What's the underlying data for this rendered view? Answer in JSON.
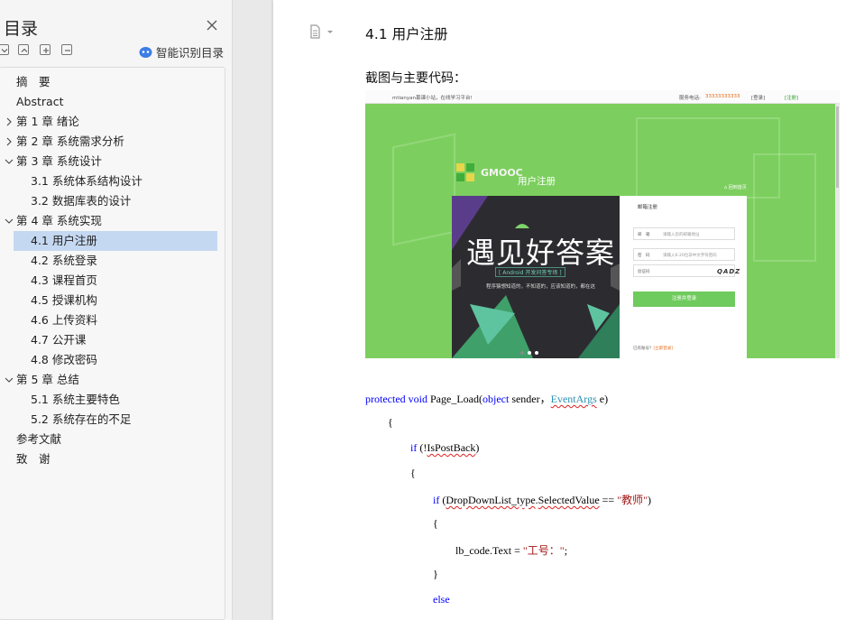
{
  "sidebar": {
    "title": "目录",
    "smart_toc_label": "智能识别目录",
    "toc": [
      {
        "label": "摘　要",
        "level": 1,
        "expanded": null,
        "selected": false
      },
      {
        "label": "Abstract",
        "level": 1,
        "expanded": null,
        "selected": false
      },
      {
        "label": "第 1 章  绪论",
        "level": 1,
        "expanded": false,
        "selected": false
      },
      {
        "label": "第 2 章  系统需求分析",
        "level": 1,
        "expanded": false,
        "selected": false
      },
      {
        "label": "第 3 章  系统设计",
        "level": 1,
        "expanded": true,
        "selected": false
      },
      {
        "label": "3.1 系统体系结构设计",
        "level": 2,
        "expanded": null,
        "selected": false
      },
      {
        "label": "3.2 数据库表的设计",
        "level": 2,
        "expanded": null,
        "selected": false
      },
      {
        "label": "第 4 章  系统实现",
        "level": 1,
        "expanded": true,
        "selected": false
      },
      {
        "label": "4.1 用户注册",
        "level": 2,
        "expanded": null,
        "selected": true
      },
      {
        "label": "4.2 系统登录",
        "level": 2,
        "expanded": null,
        "selected": false
      },
      {
        "label": "4.3 课程首页",
        "level": 2,
        "expanded": null,
        "selected": false
      },
      {
        "label": "4.5 授课机构",
        "level": 2,
        "expanded": null,
        "selected": false
      },
      {
        "label": "4.6 上传资料",
        "level": 2,
        "expanded": null,
        "selected": false
      },
      {
        "label": "4.7 公开课",
        "level": 2,
        "expanded": null,
        "selected": false
      },
      {
        "label": "4.8 修改密码",
        "level": 2,
        "expanded": null,
        "selected": false
      },
      {
        "label": "第 5 章  总结",
        "level": 1,
        "expanded": true,
        "selected": false
      },
      {
        "label": "5.1 系统主要特色",
        "level": 2,
        "expanded": null,
        "selected": false
      },
      {
        "label": "5.2 系统存在的不足",
        "level": 2,
        "expanded": null,
        "selected": false
      },
      {
        "label": "参考文献",
        "level": 1,
        "expanded": null,
        "selected": false
      },
      {
        "label": "致　谢",
        "level": 1,
        "expanded": null,
        "selected": false
      }
    ]
  },
  "document": {
    "heading": "4.1 用户注册",
    "caption": "截图与主要代码：",
    "screenshot": {
      "top_greeting": "mtianyan慕课小站，在线学习平台!",
      "phone_label": "服务电话:",
      "phone_value": "33333333333",
      "login_link": "[登录]",
      "register_link": "[注册]",
      "brand": "GMOOC",
      "subtitle": "用户注册",
      "home_link": "回到首页",
      "banner_big": "遇见好答案",
      "banner_tag": "[ Android 开发问答专场 ]",
      "banner_line": "程序猿想知道的，不知道的，应该知道的，都在这",
      "form_tab": "邮箱注册",
      "email_label": "邮　箱",
      "email_placeholder": "请输入您的邮箱地址",
      "password_label": "密　码",
      "password_placeholder": "请输入6-20位非中文字符密码",
      "captcha_label": "验证码",
      "captcha_text": "QADZ",
      "submit_label": "注册并登录",
      "have_account": "已有账号？",
      "login_now": "[立即登录]"
    },
    "code": {
      "l1_kw1": "protected",
      "l1_kw2": "void",
      "l1_name": " Page_Load(",
      "l1_kw3": "object",
      "l1_mid": " sender，",
      "l1_type": "EventArgs",
      "l1_end": " e)",
      "l2": "{",
      "l3_kw": "if",
      "l3_a": " (!",
      "l3_sq": "IsPostBack",
      "l3_b": ")",
      "l4": "{",
      "l5_kw": "if",
      "l5_a": " (",
      "l5_sq": "DropDownList_type",
      "l5_b": ".",
      "l5_sq2": "SelectedValue",
      "l5_c": " == ",
      "l5_str": "\"教师\"",
      "l5_d": ")",
      "l6": "{",
      "l7_a": "lb_code.Text = ",
      "l7_str": "\"工号：\"",
      "l7_b": ";",
      "l8": "}",
      "l9_kw": "else"
    }
  },
  "colors": {
    "selection": "#c5d8f1",
    "keyword": "#0000ff",
    "type": "#2b91af",
    "string": "#a31515",
    "screenshot_green": "#7ccf5e"
  }
}
